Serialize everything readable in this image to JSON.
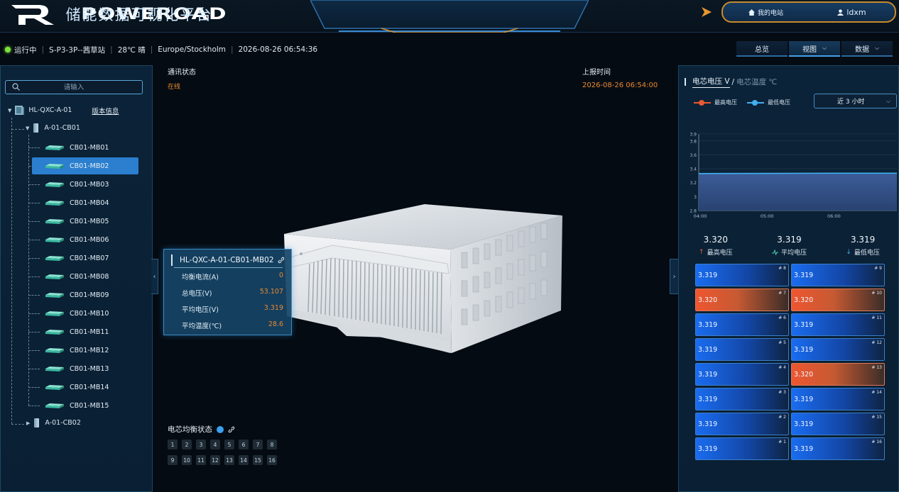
{
  "header": {
    "brand": "POWEROAD",
    "title": "储能数据可视化平台",
    "my_station": "我的电站",
    "username": "ldxm"
  },
  "status": {
    "state": "运行中",
    "station": "S-P3-3P--茜草站",
    "weather": "28℃ 晴",
    "timezone": "Europe/Stockholm",
    "datetime": "2026-08-26 06:54:36"
  },
  "nav": {
    "overview": "总览",
    "view": "视图",
    "data": "数据"
  },
  "sidebar": {
    "search_placeholder": "请输入",
    "root": "HL-QXC-A-01",
    "version_link": "版本信息",
    "cluster1": "A-01-CB01",
    "cluster2": "A-01-CB02",
    "modules": [
      "CB01-MB01",
      "CB01-MB02",
      "CB01-MB03",
      "CB01-MB04",
      "CB01-MB05",
      "CB01-MB06",
      "CB01-MB07",
      "CB01-MB08",
      "CB01-MB09",
      "CB01-MB10",
      "CB01-MB11",
      "CB01-MB12",
      "CB01-MB13",
      "CB01-MB14",
      "CB01-MB15"
    ],
    "selected_index": 1
  },
  "center": {
    "comm_label": "通讯状态",
    "comm_value": "在线",
    "report_label": "上报时间",
    "report_value": "2026-08-26 06:54:00",
    "card": {
      "title": "HL-QXC-A-01-CB01-MB02",
      "rows": [
        {
          "label": "均衡电流(A)",
          "value": "0"
        },
        {
          "label": "总电压(V)",
          "value": "53.107"
        },
        {
          "label": "平均电压(V)",
          "value": "3.319"
        },
        {
          "label": "平均温度(℃)",
          "value": "28.6"
        }
      ]
    },
    "balance_title": "电芯均衡状态",
    "balance_cells": [
      "1",
      "2",
      "3",
      "4",
      "5",
      "6",
      "7",
      "8",
      "9",
      "10",
      "11",
      "12",
      "13",
      "14",
      "15",
      "16"
    ]
  },
  "right": {
    "tab_voltage": "电芯电压 V",
    "slash": "/",
    "tab_temp": "电芯温度 ℃",
    "legend_max": "最高电压",
    "legend_min": "最低电压",
    "range": "近 3 小时",
    "stats": [
      {
        "value": "3.320",
        "label": "最高电压"
      },
      {
        "value": "3.319",
        "label": "平均电压"
      },
      {
        "value": "3.319",
        "label": "最低电压"
      }
    ],
    "cells": [
      {
        "value": "3.319",
        "index": "# 8",
        "hot": false
      },
      {
        "value": "3.319",
        "index": "# 9",
        "hot": false
      },
      {
        "value": "3.320",
        "index": "# 7",
        "hot": true
      },
      {
        "value": "3.320",
        "index": "# 10",
        "hot": true
      },
      {
        "value": "3.319",
        "index": "# 6",
        "hot": false
      },
      {
        "value": "3.319",
        "index": "# 11",
        "hot": false
      },
      {
        "value": "3.319",
        "index": "# 5",
        "hot": false
      },
      {
        "value": "3.319",
        "index": "# 12",
        "hot": false
      },
      {
        "value": "3.319",
        "index": "# 4",
        "hot": false
      },
      {
        "value": "3.320",
        "index": "# 13",
        "hot": true
      },
      {
        "value": "3.319",
        "index": "# 3",
        "hot": false
      },
      {
        "value": "3.319",
        "index": "# 14",
        "hot": false
      },
      {
        "value": "3.319",
        "index": "# 2",
        "hot": false
      },
      {
        "value": "3.319",
        "index": "# 15",
        "hot": false
      },
      {
        "value": "3.319",
        "index": "# 1",
        "hot": false
      },
      {
        "value": "3.319",
        "index": "# 16",
        "hot": false
      }
    ]
  },
  "chart_data": {
    "type": "area",
    "x": [
      "04:00",
      "05:00",
      "06:00"
    ],
    "x_ticks": [
      "04:00",
      "05:00",
      "06:00"
    ],
    "y_ticks": [
      "3.9",
      "3.8",
      "3.6",
      "3.4",
      "3.2",
      "3",
      "2.8"
    ],
    "ylim": [
      2.8,
      3.9
    ],
    "series": [
      {
        "name": "最高电压",
        "values": [
          3.333,
          3.335,
          3.338
        ],
        "color": "#ea5a34"
      },
      {
        "name": "最低电压",
        "values": [
          3.332,
          3.334,
          3.337
        ],
        "color": "#40b0f0"
      }
    ],
    "grid": true
  }
}
